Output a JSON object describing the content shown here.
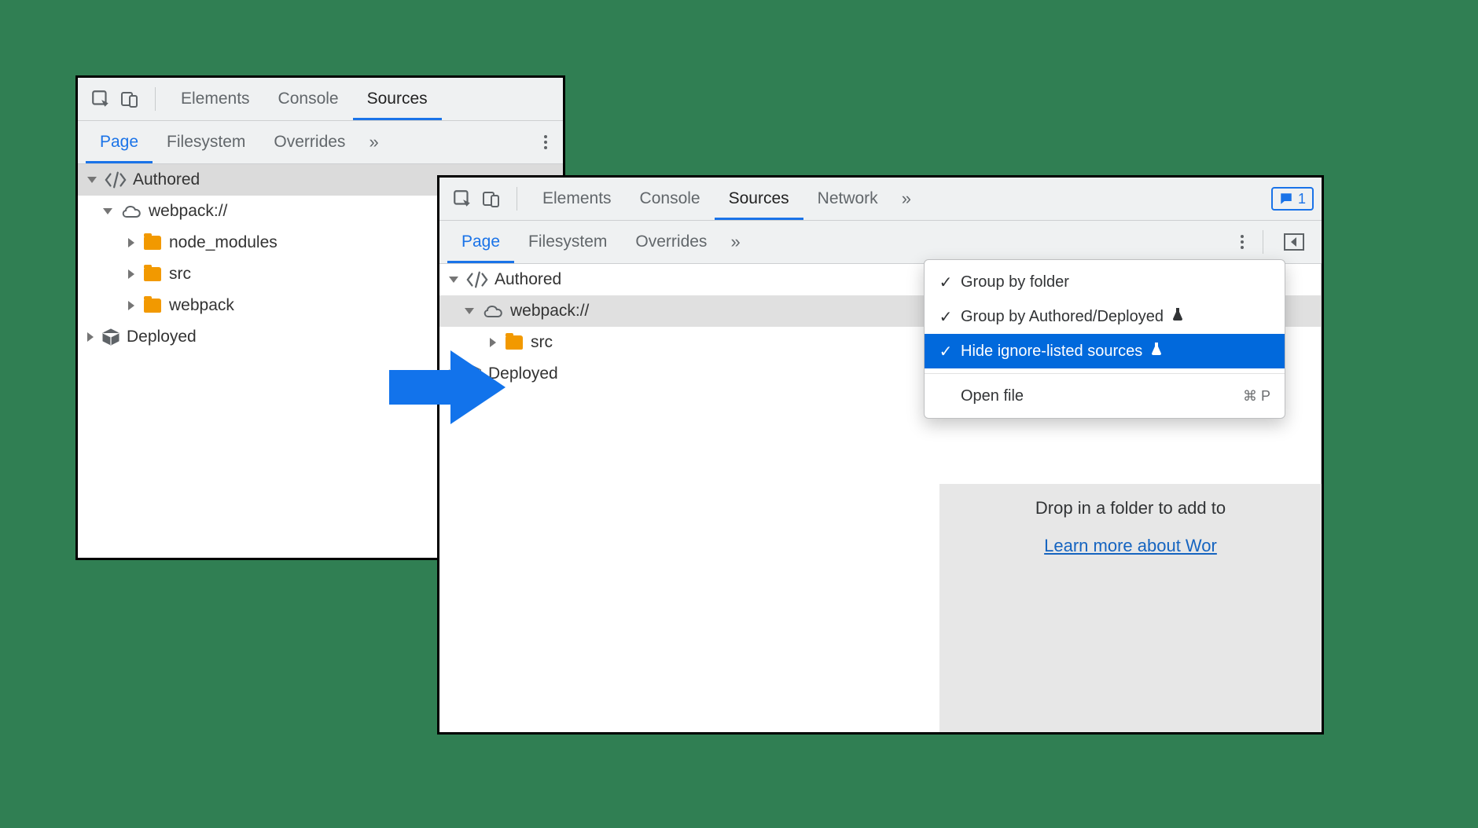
{
  "leftPanel": {
    "tabsTop": [
      "Elements",
      "Console",
      "Sources"
    ],
    "activeTopIndex": 2,
    "tabsSub": [
      "Page",
      "Filesystem",
      "Overrides"
    ],
    "activeSubIndex": 0,
    "tree": {
      "authored": "Authored",
      "webpack": "webpack://",
      "nodeModules": "node_modules",
      "src": "src",
      "webpackFolder": "webpack",
      "deployed": "Deployed"
    }
  },
  "rightPanel": {
    "tabsTop": [
      "Elements",
      "Console",
      "Sources",
      "Network"
    ],
    "activeTopIndex": 2,
    "messageCount": "1",
    "tabsSub": [
      "Page",
      "Filesystem",
      "Overrides"
    ],
    "activeSubIndex": 0,
    "tree": {
      "authored": "Authored",
      "webpack": "webpack://",
      "src": "src",
      "deployed": "Deployed"
    },
    "contextMenu": {
      "items": [
        {
          "label": "Group by folder",
          "checked": true,
          "flask": false
        },
        {
          "label": "Group by Authored/Deployed",
          "checked": true,
          "flask": true
        },
        {
          "label": "Hide ignore-listed sources",
          "checked": true,
          "flask": true,
          "highlighted": true
        }
      ],
      "openFile": {
        "label": "Open file",
        "shortcut": "⌘ P"
      }
    },
    "hint": {
      "line1": "Drop in a folder to add to",
      "link": "Learn more about Wor"
    }
  }
}
